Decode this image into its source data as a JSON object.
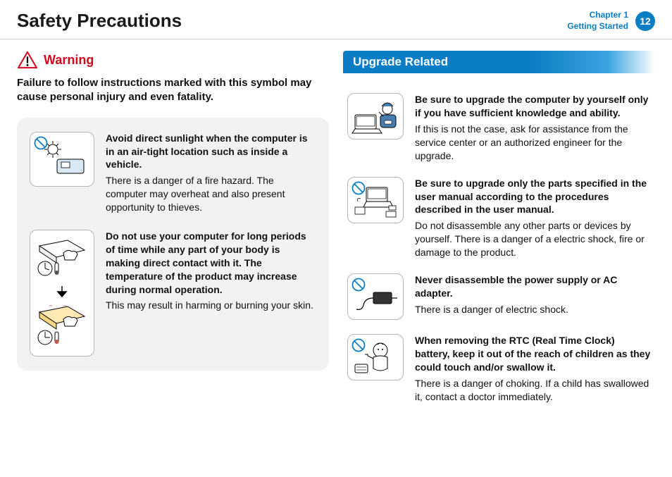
{
  "header": {
    "title": "Safety Precautions",
    "chapter_line1": "Chapter 1",
    "chapter_line2": "Getting Started",
    "page": "12"
  },
  "left": {
    "warning_label": "Warning",
    "warning_text": "Failure to follow instructions marked with this symbol may cause personal injury and even fatality.",
    "items": [
      {
        "bold": "Avoid direct sunlight when the computer is in an air-tight location such as inside a vehicle.",
        "body": "There is a danger of a fire hazard. The computer may overheat and also present opportunity to thieves."
      },
      {
        "bold": "Do not use your computer for long periods of time while any part of your body is making direct contact with it. The temperature of the product may increase during normal operation.",
        "body": "This may result in harming or burning your skin."
      }
    ]
  },
  "right": {
    "section_title": "Upgrade Related",
    "items": [
      {
        "bold": "Be sure to upgrade the computer by yourself only if you have sufficient knowledge and ability.",
        "body": "If this is not the case, ask for assistance from the service center or an authorized engineer for the upgrade."
      },
      {
        "bold": "Be sure to upgrade only the parts specified in the user manual according to the procedures described in the user manual.",
        "body": "Do not disassemble any other parts or devices by yourself. There is a danger of a electric shock, fire or damage to the product."
      },
      {
        "bold": "Never disassemble the power supply or AC adapter.",
        "body": "There is a danger of electric shock."
      },
      {
        "bold": "When removing the RTC (Real Time Clock) battery, keep it out of the reach of children as they could touch and/or swallow it.",
        "body": "There is a danger of choking. If a child has swallowed it, contact a doctor immediately."
      }
    ]
  }
}
